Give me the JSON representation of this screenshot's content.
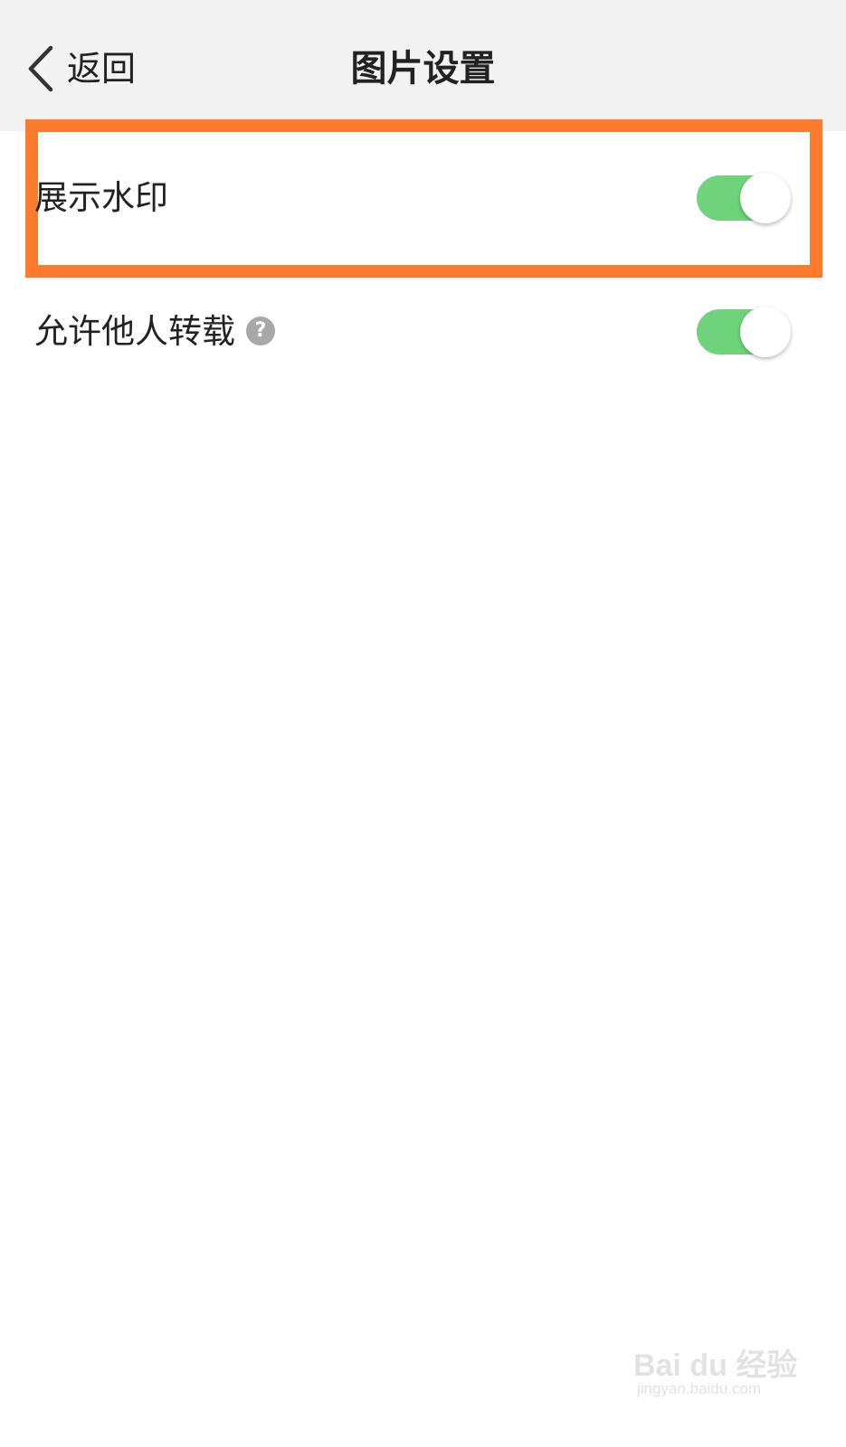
{
  "header": {
    "back_label": "返回",
    "title": "图片设置"
  },
  "settings": [
    {
      "label": "展示水印",
      "enabled": true,
      "highlighted": true
    },
    {
      "label": "允许他人转载",
      "enabled": true,
      "has_help": true,
      "help_glyph": "?"
    }
  ],
  "watermark": {
    "brand": "Bai du 经验",
    "url": "jingyan.baidu.com"
  },
  "colors": {
    "toggle_on": "#6fd37c",
    "highlight": "#fb7a2c",
    "header_bg": "#f2f2f2"
  }
}
